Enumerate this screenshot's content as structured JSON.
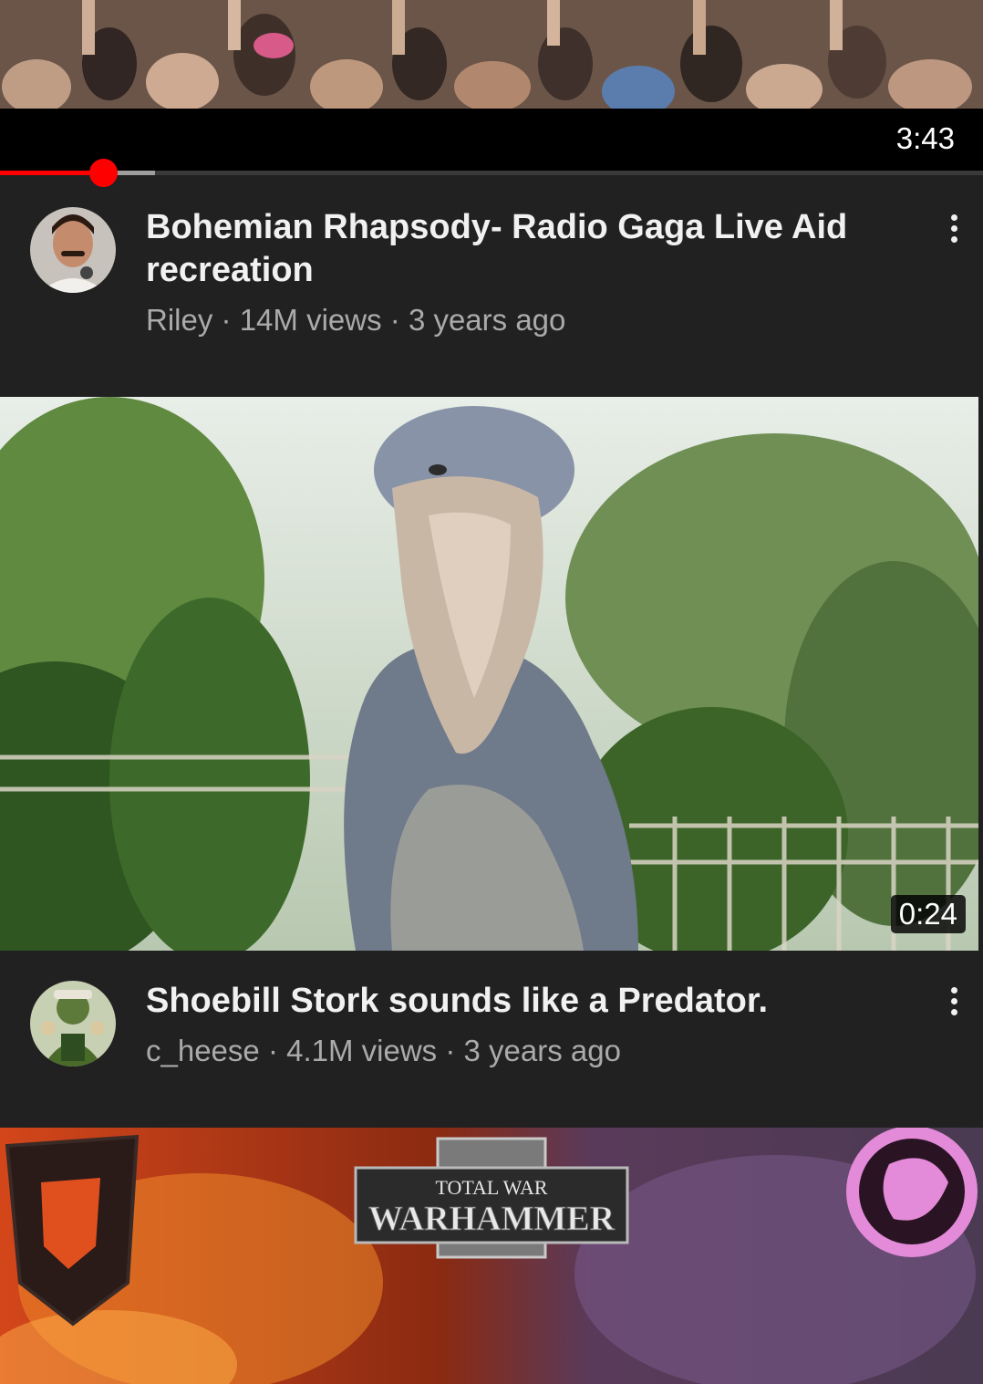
{
  "videos": [
    {
      "duration": "3:43",
      "title": "Bohemian Rhapsody- Radio Gaga Live Aid recreation",
      "channel": "Riley",
      "views": "14M views",
      "age": "3 years ago",
      "sep": "·",
      "progress_fraction": 0.105,
      "buffered_fraction": 0.158
    },
    {
      "duration": "0:24",
      "title": "Shoebill Stork sounds like a Predator.",
      "channel": "c_heese",
      "views": "4.1M views",
      "age": "3 years ago",
      "sep": "·"
    },
    {
      "thumbnail_logo_top": "TOTAL WAR",
      "thumbnail_logo_main": "WARHAMMER"
    }
  ],
  "colors": {
    "progress": "#ff0000",
    "background": "#212121",
    "title": "#f1f1f1",
    "meta": "#aaaaaa"
  },
  "icons": [
    "more-vert-icon"
  ]
}
